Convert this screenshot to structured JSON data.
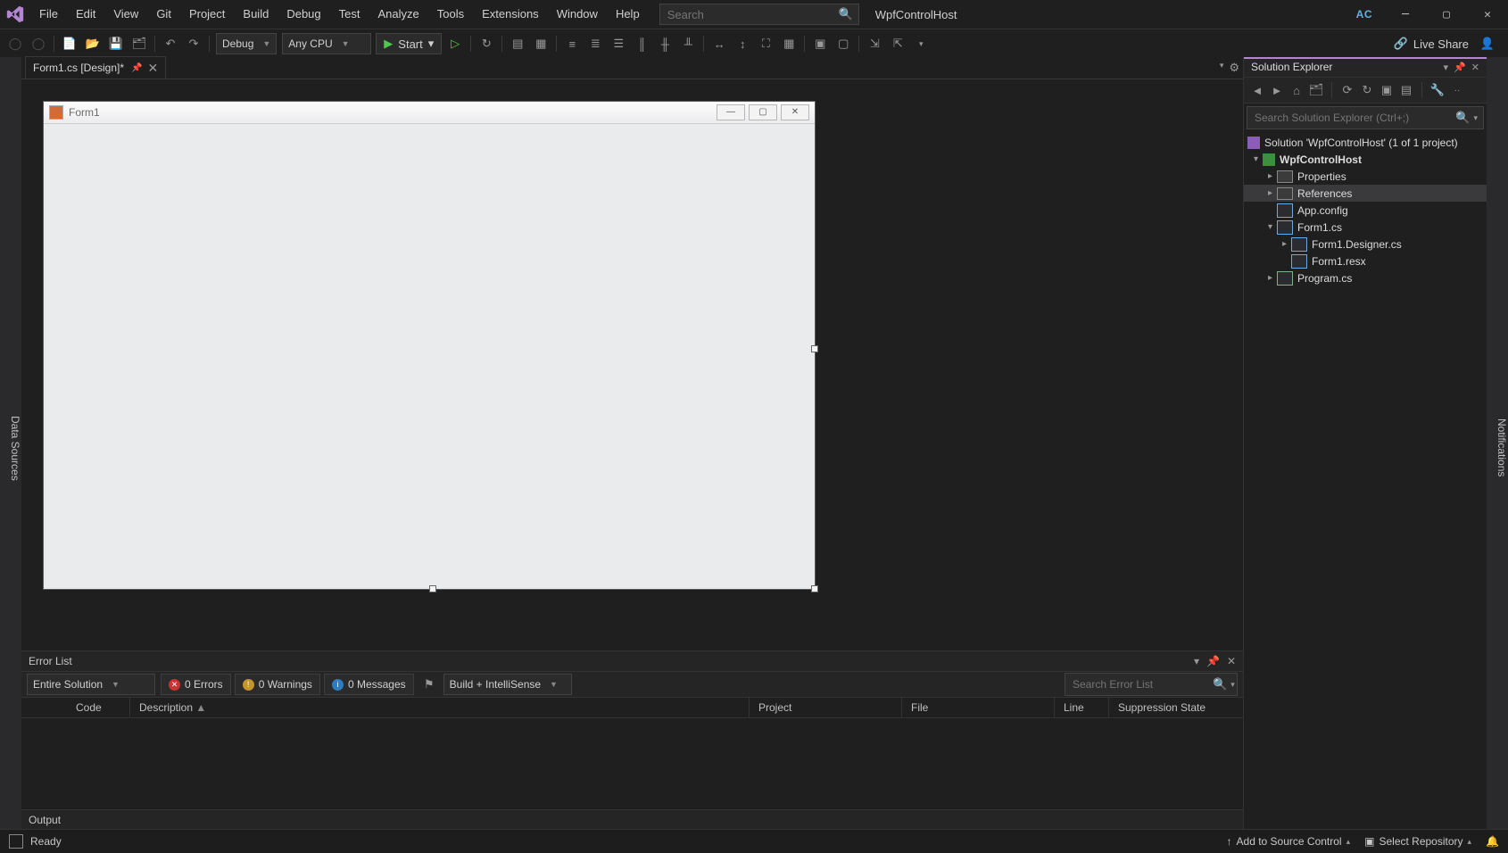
{
  "app": {
    "title": "WpfControlHost",
    "user_badge": "AC"
  },
  "menu": [
    "File",
    "Edit",
    "View",
    "Git",
    "Project",
    "Build",
    "Debug",
    "Test",
    "Analyze",
    "Tools",
    "Extensions",
    "Window",
    "Help"
  ],
  "title_search": {
    "placeholder": "Search"
  },
  "toolbar": {
    "config": "Debug",
    "platform": "Any CPU",
    "start_label": "Start",
    "live_share": "Live Share"
  },
  "left_rail": "Data Sources",
  "right_rail": "Notifications",
  "tabs": [
    {
      "label": "Form1.cs [Design]*",
      "pinned": false
    }
  ],
  "designer": {
    "form_title": "Form1"
  },
  "error_list": {
    "title": "Error List",
    "scope": "Entire Solution",
    "errors_label": "0 Errors",
    "warnings_label": "0 Warnings",
    "messages_label": "0 Messages",
    "filter": "Build + IntelliSense",
    "search_placeholder": "Search Error List",
    "columns": [
      "",
      "Code",
      "Description",
      "Project",
      "File",
      "Line",
      "Suppression State"
    ]
  },
  "output": {
    "title": "Output"
  },
  "solution_explorer": {
    "title": "Solution Explorer",
    "search_placeholder": "Search Solution Explorer (Ctrl+;)",
    "solution_label": "Solution 'WpfControlHost' (1 of 1 project)",
    "project": "WpfControlHost",
    "nodes": {
      "properties": "Properties",
      "references": "References",
      "appconfig": "App.config",
      "form1": "Form1.cs",
      "form1_designer": "Form1.Designer.cs",
      "form1_resx": "Form1.resx",
      "program": "Program.cs"
    }
  },
  "statusbar": {
    "ready": "Ready",
    "add_source_control": "Add to Source Control",
    "select_repo": "Select Repository"
  }
}
